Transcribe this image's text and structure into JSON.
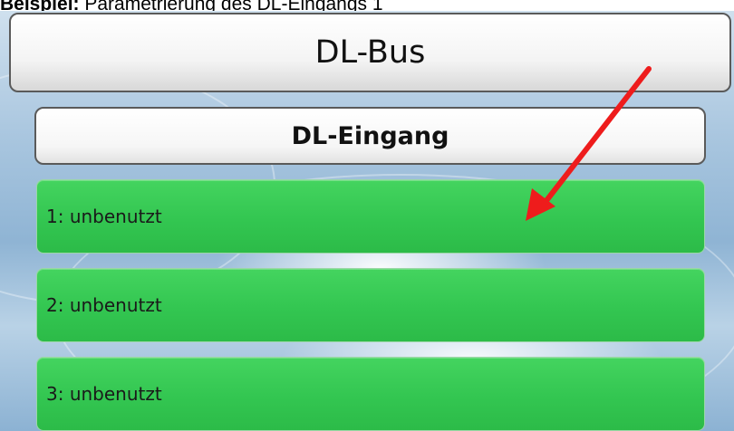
{
  "caption": {
    "bold": "Beispiel:",
    "text": " Parametrierung des DL-Eingangs 1"
  },
  "header": {
    "title": "DL-Bus"
  },
  "subheader": {
    "title": "DL-Eingang"
  },
  "inputs": [
    {
      "label": "1: unbenutzt"
    },
    {
      "label": "2: unbenutzt"
    },
    {
      "label": "3: unbenutzt"
    }
  ],
  "annotation": {
    "icon": "red-arrow-icon",
    "color": "#ee1c1c"
  },
  "colors": {
    "item_green": "#33c651",
    "background_blue": "#a9c6df"
  }
}
